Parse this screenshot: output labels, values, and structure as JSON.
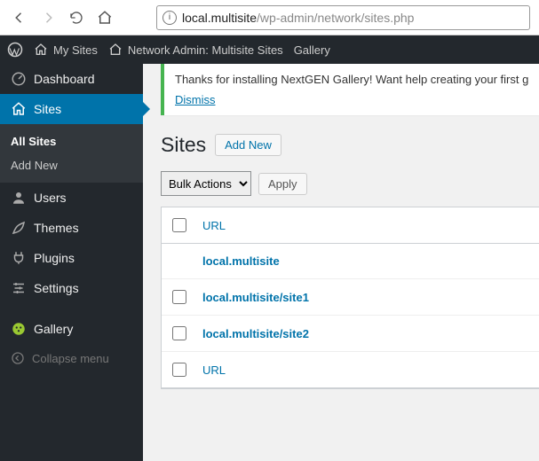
{
  "browser": {
    "url_prefix": "",
    "url_host": "local.multisite",
    "url_path": "/wp-admin/network/sites.php"
  },
  "adminbar": {
    "mysites": "My Sites",
    "network_admin": "Network Admin: Multisite Sites",
    "gallery": "Gallery"
  },
  "sidebar": {
    "dashboard": "Dashboard",
    "sites": "Sites",
    "sites_sub": {
      "all": "All Sites",
      "add": "Add New"
    },
    "users": "Users",
    "themes": "Themes",
    "plugins": "Plugins",
    "settings": "Settings",
    "gallery": "Gallery",
    "collapse": "Collapse menu"
  },
  "notice": {
    "text": "Thanks for installing NextGEN Gallery! Want help creating your first g",
    "dismiss": "Dismiss"
  },
  "page": {
    "title": "Sites",
    "add_new": "Add New"
  },
  "bulk": {
    "label": "Bulk Actions",
    "apply": "Apply"
  },
  "table": {
    "col_url": "URL",
    "rows": [
      {
        "url": "local.multisite"
      },
      {
        "url": "local.multisite/site1"
      },
      {
        "url": "local.multisite/site2"
      }
    ]
  }
}
